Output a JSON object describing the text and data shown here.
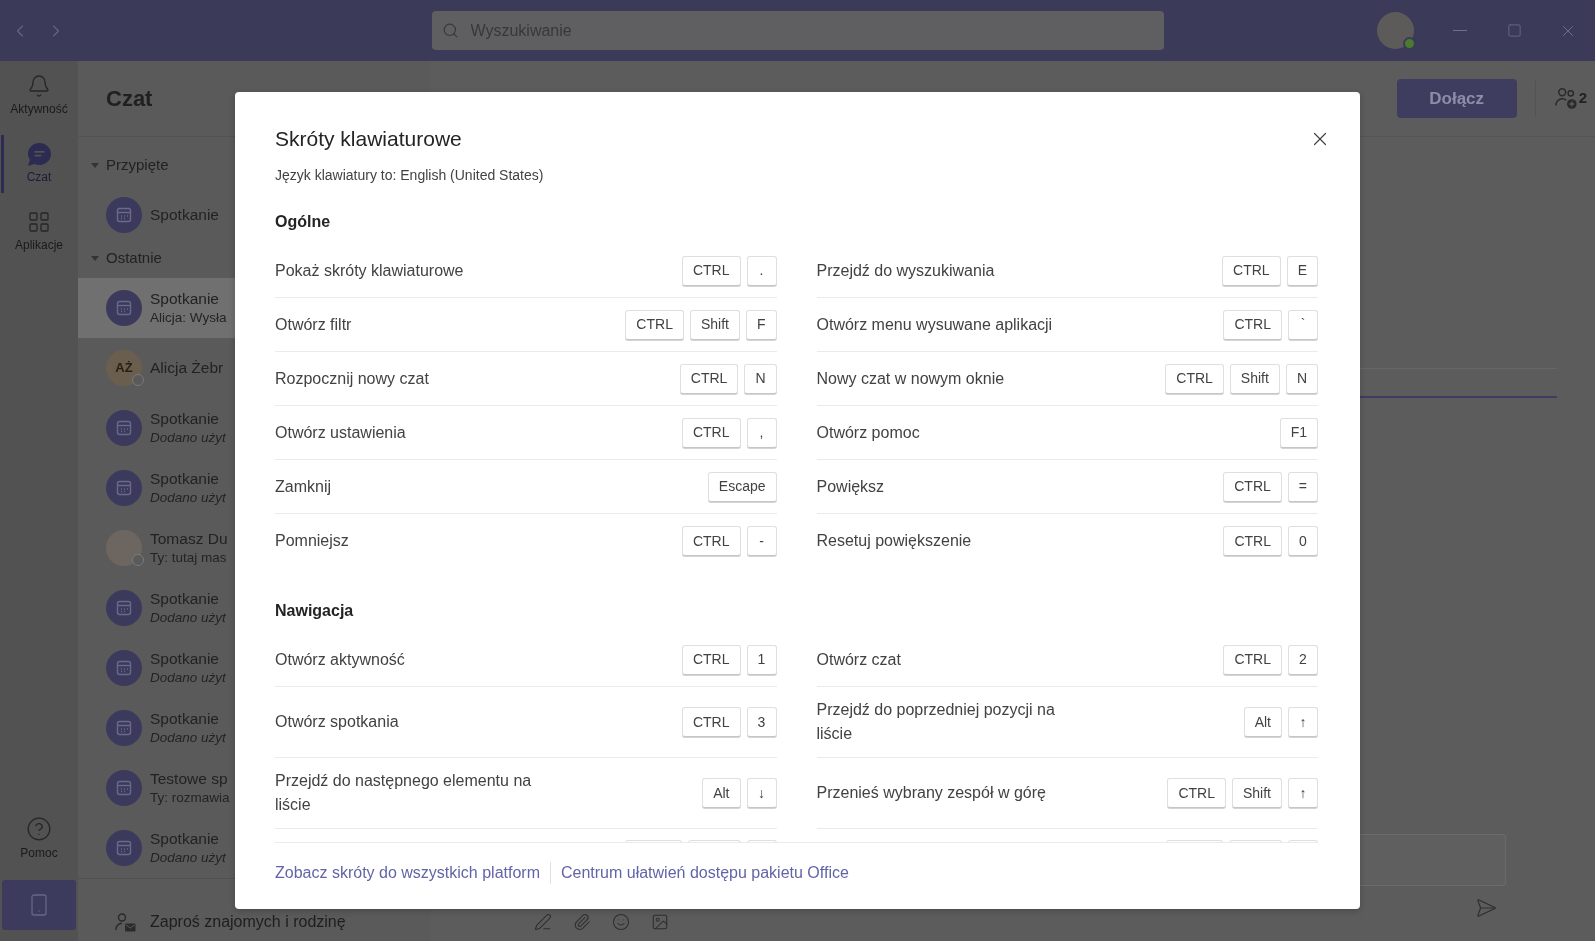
{
  "title_bar": {
    "search": {
      "placeholder": "Wyszukiwanie"
    },
    "account": {
      "online": true
    }
  },
  "app_rail": {
    "items": [
      {
        "label": "Aktywność",
        "kind": "bell",
        "selected": false
      },
      {
        "label": "Czat",
        "kind": "chat",
        "selected": true
      },
      {
        "label": "Aplikacje",
        "kind": "apps",
        "selected": false
      }
    ],
    "help": {
      "label": "Pomoc"
    }
  },
  "chat_list": {
    "title": "Czat",
    "sections": [
      {
        "label": "Przypięte",
        "expanded": true,
        "items": [
          {
            "kind": "meeting",
            "name": "Spotkanie",
            "selected": false
          }
        ]
      },
      {
        "label": "Ostatnie",
        "expanded": true,
        "items": [
          {
            "kind": "meeting",
            "name": "Spotkanie",
            "preview": "Alicja: Wysła",
            "system": false,
            "selected": true
          },
          {
            "kind": "initials",
            "initials": "AŻ",
            "name": "Alicja Żebr",
            "online": false,
            "selected": false
          },
          {
            "kind": "meeting",
            "name": "Spotkanie",
            "preview": "Dodano użyt",
            "system": true,
            "selected": false
          },
          {
            "kind": "meeting",
            "name": "Spotkanie",
            "preview": "Dodano użyt",
            "system": true,
            "selected": false
          },
          {
            "kind": "photo",
            "name": "Tomasz Du",
            "preview": "Ty: tutaj mas",
            "system": false,
            "online": false,
            "selected": false
          },
          {
            "kind": "meeting",
            "name": "Spotkanie",
            "preview": "Dodano użyt",
            "system": true,
            "selected": false
          },
          {
            "kind": "meeting",
            "name": "Spotkanie",
            "preview": "Dodano użyt",
            "system": true,
            "selected": false
          },
          {
            "kind": "meeting",
            "name": "Spotkanie",
            "preview": "Dodano użyt",
            "system": true,
            "selected": false
          },
          {
            "kind": "meeting",
            "name": "Testowe sp",
            "preview": "Ty: rozmawia",
            "system": false,
            "selected": false
          },
          {
            "kind": "meeting",
            "name": "Spotkanie",
            "preview": "Dodano użyt",
            "system": true,
            "selected": false
          }
        ]
      }
    ],
    "invite": "Zaproś znajomych i rodzinę"
  },
  "meeting": {
    "join_button": "Dołącz",
    "participants": "2"
  },
  "dialog": {
    "title": "Skróty klawiaturowe",
    "subtitle": "Język klawiatury to: English (United States)",
    "sections": [
      {
        "title": "Ogólne",
        "shortcuts": [
          {
            "label": "Pokaż skróty klawiaturowe",
            "keys": [
              "CTRL",
              "."
            ]
          },
          {
            "label": "Otwórz filtr",
            "keys": [
              "CTRL",
              "Shift",
              "F"
            ]
          },
          {
            "label": "Rozpocznij nowy czat",
            "keys": [
              "CTRL",
              "N"
            ]
          },
          {
            "label": "Otwórz ustawienia",
            "keys": [
              "CTRL",
              ","
            ]
          },
          {
            "label": "Zamknij",
            "keys": [
              "Escape"
            ]
          },
          {
            "label": "Pomniejsz",
            "keys": [
              "CTRL",
              "-"
            ]
          },
          {
            "label": "Przejdź do wyszukiwania",
            "keys": [
              "CTRL",
              "E"
            ]
          },
          {
            "label": "Otwórz menu wysuwane aplikacji",
            "keys": [
              "CTRL",
              "`"
            ]
          },
          {
            "label": "Nowy czat w nowym oknie",
            "keys": [
              "CTRL",
              "Shift",
              "N"
            ]
          },
          {
            "label": "Otwórz pomoc",
            "keys": [
              "F1"
            ]
          },
          {
            "label": "Powiększ",
            "keys": [
              "CTRL",
              "="
            ]
          },
          {
            "label": "Resetuj powiększenie",
            "keys": [
              "CTRL",
              "0"
            ]
          }
        ]
      },
      {
        "title": "Nawigacja",
        "shortcuts": [
          {
            "label": "Otwórz aktywność",
            "keys": [
              "CTRL",
              "1"
            ]
          },
          {
            "label": "Otwórz spotkania",
            "keys": [
              "CTRL",
              "3"
            ]
          },
          {
            "label": "Przejdź do następnego elementu na liście",
            "keys": [
              "Alt",
              "↓"
            ]
          },
          {
            "label": "Otwórz czat",
            "keys": [
              "CTRL",
              "2"
            ]
          },
          {
            "label": "Przejdź do poprzedniej pozycji na liście",
            "keys": [
              "Alt",
              "↑"
            ]
          },
          {
            "label": "Przenieś wybrany zespół w górę",
            "keys": [
              "CTRL",
              "Shift",
              "↑"
            ]
          }
        ],
        "partial_row": {
          "left_keys": [
            {
              "kind": "wide"
            },
            {
              "kind": "medium"
            },
            {
              "kind": "narrow"
            }
          ],
          "right_keys": [
            {
              "kind": "wide"
            },
            {
              "kind": "medium"
            },
            {
              "kind": "narrow"
            }
          ]
        }
      }
    ],
    "links": [
      "Zobacz skróty do wszystkich platform",
      "Centrum ułatwień dostępu pakietu Office"
    ]
  }
}
